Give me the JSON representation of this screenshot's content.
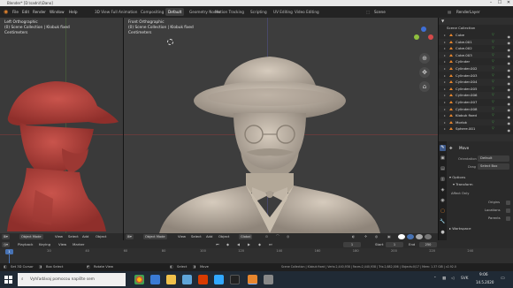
{
  "window": {
    "title": "Blender* [D:\\sadn\\\\\\Dano]",
    "min": "–",
    "max": "☐",
    "close": "✕"
  },
  "menu": {
    "file": "File",
    "edit": "Edit",
    "render": "Render",
    "window": "Window",
    "help": "Help",
    "workspaces": [
      "3D View Full",
      "Animation",
      "Compositing",
      "Default",
      "Geometry Nodes",
      "Motion Tracking",
      "Scripting",
      "UV Editing",
      "Video Editing"
    ],
    "active_workspace": "Default",
    "scene_label": "Scene",
    "view_layer": "RenderLayer"
  },
  "viewport_left": {
    "line1": "Left Orthographic",
    "line2": "(0) Scene Collection | Klobuk fixed",
    "line3": "Centimeters",
    "mode": "Object Mode",
    "view": "View",
    "select": "Select",
    "add": "Add",
    "object": "Object"
  },
  "viewport_right": {
    "line1": "Front Orthographic",
    "line2": "(0) Scene Collection | Klobuk fixed",
    "line3": "Centimeters",
    "mode": "Object Mode",
    "view": "View",
    "select": "Select",
    "add": "Add",
    "object": "Object",
    "transform": "Global"
  },
  "outliner": {
    "header": "Scene Collection",
    "items": [
      {
        "name": "Cube"
      },
      {
        "name": "Cube.001"
      },
      {
        "name": "Cube.002"
      },
      {
        "name": "Cube.003"
      },
      {
        "name": "Cylinder"
      },
      {
        "name": "Cylinder.002"
      },
      {
        "name": "Cylinder.003"
      },
      {
        "name": "Cylinder.004"
      },
      {
        "name": "Cylinder.005"
      },
      {
        "name": "Cylinder.006"
      },
      {
        "name": "Cylinder.007"
      },
      {
        "name": "Cylinder.008"
      },
      {
        "name": "Klobuk fixed"
      },
      {
        "name": "Morlok"
      },
      {
        "name": "Sphere.001"
      }
    ]
  },
  "properties": {
    "tool_header": "Move",
    "orientation_label": "Orientation",
    "orientation_value": "Default",
    "drag_label": "Drag",
    "drag_value": "Select Box",
    "options": "Options",
    "transform": "Transform",
    "affect_only": "Affect Only",
    "origins": "Origins",
    "locations": "Locations",
    "parents": "Parents",
    "workspace": "Workspace"
  },
  "timeline": {
    "playback": "Playback",
    "keying": "Keying",
    "view": "View",
    "marker": "Marker",
    "current_frame": "1",
    "start_label": "Start",
    "start": "1",
    "end_label": "End",
    "end": "250",
    "ticks": [
      "20",
      "40",
      "60",
      "80",
      "100",
      "120",
      "140",
      "160",
      "180",
      "200",
      "220",
      "240"
    ]
  },
  "status": {
    "set_cursor": "Set 3D Cursor",
    "box_select": "Box Select",
    "rotate_view": "Rotate View",
    "select": "Select",
    "move": "Move",
    "stats": "Scene Collection | Klobuk fixed | Verts:2,440,938 | Faces:2,440,938 | Tris:2,882,006 | Objects:0/17 | Mem: 1.37 GiB | v2.92.0"
  },
  "taskbar": {
    "search_placeholder": "Vyhľadávaj pomocou napíšte sem",
    "time": "9:06",
    "date": "14.5.2020",
    "lang": "SVK"
  },
  "colors": {
    "accent_blue": "#4772b3",
    "object_orange": "#e7862e",
    "bust_red": "#b1463f",
    "bust_clay": "#b9ad9d"
  }
}
